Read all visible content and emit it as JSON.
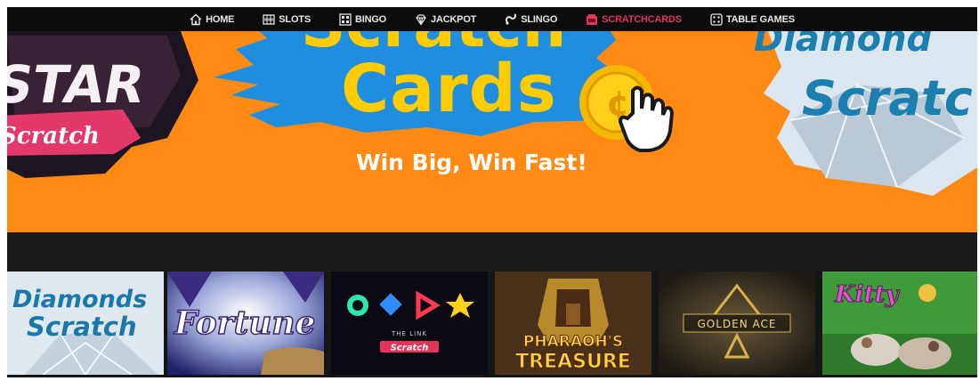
{
  "nav": {
    "items": [
      {
        "label": "HOME",
        "icon": "home-icon",
        "active": false
      },
      {
        "label": "SLOTS",
        "icon": "slots-icon",
        "active": false
      },
      {
        "label": "BINGO",
        "icon": "bingo-icon",
        "active": false
      },
      {
        "label": "JACKPOT",
        "icon": "diamond-icon",
        "active": false
      },
      {
        "label": "SLINGO",
        "icon": "slingo-icon",
        "active": false
      },
      {
        "label": "SCRATCHCARDS",
        "icon": "scratchcards-icon",
        "active": true
      },
      {
        "label": "TABLE GAMES",
        "icon": "table-games-icon",
        "active": false
      }
    ],
    "active_color": "#e0345a"
  },
  "banner": {
    "title_top": "Scratch",
    "title_main": "Cards",
    "tagline": "Win Big, Win Fast!",
    "left_card": {
      "title": "STAR",
      "subtitle": "Scratch"
    },
    "right_card": {
      "title": "Diamond",
      "subtitle": "Scratc"
    },
    "background_color": "#fe8a14"
  },
  "games": [
    {
      "name": "Diamonds",
      "sub": "Scratch"
    },
    {
      "name": "Fortune"
    },
    {
      "name": "THE LINK",
      "sub": "Scratch"
    },
    {
      "name": "PHARAOH'S",
      "sub": "TREASURE"
    },
    {
      "name": "GOLDEN ACE"
    },
    {
      "name": "Kitty"
    }
  ]
}
